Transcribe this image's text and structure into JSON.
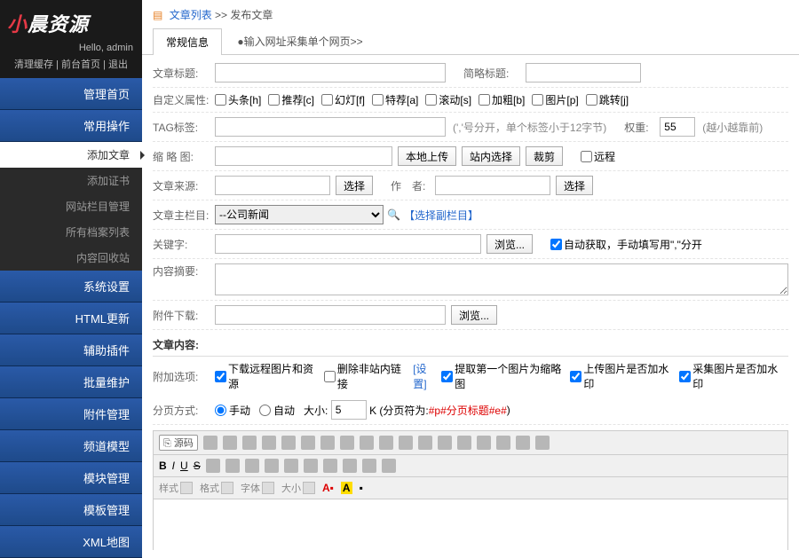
{
  "logo": {
    "left": "小",
    "mid": "晨",
    "right": "资源"
  },
  "hello": "Hello, admin",
  "toplinks": {
    "a": "清理缓存",
    "b": "前台首页",
    "c": "退出"
  },
  "nav": {
    "home": "管理首页",
    "common": "常用操作",
    "subs": [
      "添加文章",
      "添加证书",
      "网站栏目管理",
      "所有档案列表",
      "内容回收站"
    ],
    "sys": "系统设置",
    "html": "HTML更新",
    "plugin": "辅助插件",
    "batch": "批量维护",
    "attach": "附件管理",
    "channel": "频道模型",
    "module": "模块管理",
    "tpl": "模板管理",
    "xml": "XML地图"
  },
  "crumb": {
    "a": "文章列表",
    "sep": ">>",
    "b": "发布文章"
  },
  "tabs": {
    "t1": "常规信息",
    "t2": "●输入网址采集单个网页>>"
  },
  "form": {
    "title_lbl": "文章标题:",
    "short_lbl": "简略标题:",
    "attr_lbl": "自定义属性:",
    "attrs": [
      "头条[h]",
      "推荐[c]",
      "幻灯[f]",
      "特荐[a]",
      "滚动[s]",
      "加粗[b]",
      "图片[p]",
      "跳转[j]"
    ],
    "tag_lbl": "TAG标签:",
    "tag_note": "(','号分开，单个标签小于12字节)",
    "weight_lbl": "权重:",
    "weight_val": "55",
    "weight_note": "(越小越靠前)",
    "thumb_lbl": "缩 略 图:",
    "btn_local": "本地上传",
    "btn_site": "站内选择",
    "btn_crop": "裁剪",
    "remote": "远程",
    "src_lbl": "文章来源:",
    "btn_sel": "选择",
    "author_lbl": "作　者:",
    "col_lbl": "文章主栏目:",
    "col_opt": "--公司新闻",
    "col_link": "【选择副栏目】",
    "kw_lbl": "关键字:",
    "btn_browse": "浏览...",
    "kw_auto": "自动获取，手动填写用\",\"分开",
    "desc_lbl": "内容摘要:",
    "dl_lbl": "附件下载:",
    "content_lbl": "文章内容:",
    "opt_lbl": "附加选项:",
    "opts": [
      "下载远程图片和资源",
      "删除非站内链接",
      "提取第一个图片为缩略图",
      "上传图片是否加水印",
      "采集图片是否加水印"
    ],
    "opt_set": "[设置]",
    "page_lbl": "分页方式:",
    "pm_manual": "手动",
    "pm_auto": "自动",
    "pm_size": "大小:",
    "pm_val": "5",
    "pm_unit": "K (分页符为:",
    "pm_tag": "#p#分页标题#e#",
    "pm_end": ")",
    "ed_src": "源码",
    "ed_styles": {
      "style": "样式",
      "fmt": "格式",
      "font": "字体",
      "size": "大小"
    }
  }
}
